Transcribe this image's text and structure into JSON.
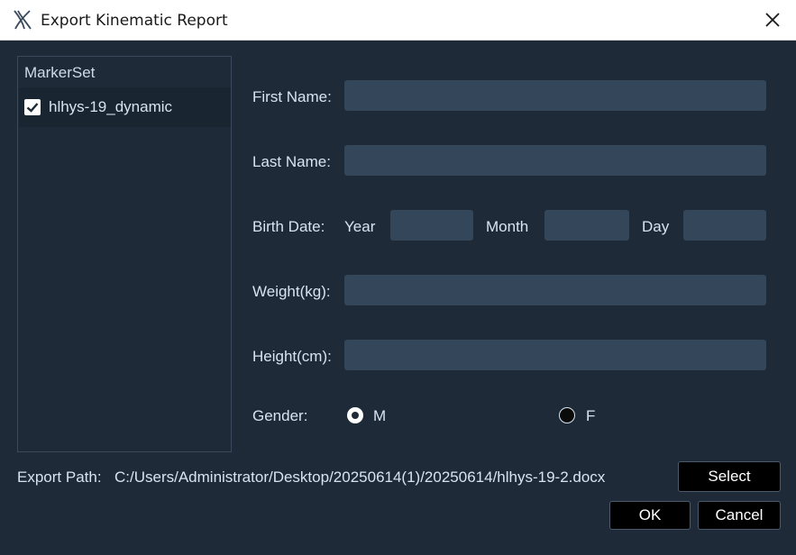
{
  "window": {
    "title": "Export Kinematic Report",
    "app_icon": "app-logo-icon",
    "close_icon": "close-icon"
  },
  "markerset": {
    "header": "MarkerSet",
    "items": [
      {
        "label": "hlhys-19_dynamic",
        "checked": true
      }
    ]
  },
  "form": {
    "first_name": {
      "label": "First Name:",
      "value": ""
    },
    "last_name": {
      "label": "Last Name:",
      "value": ""
    },
    "birth_date": {
      "label": "Birth Date:",
      "year_label": "Year",
      "year_value": "",
      "month_label": "Month",
      "month_value": "",
      "day_label": "Day",
      "day_value": ""
    },
    "weight": {
      "label": "Weight(kg):",
      "value": ""
    },
    "height": {
      "label": "Height(cm):",
      "value": ""
    },
    "gender": {
      "label": "Gender:",
      "options": [
        {
          "label": "M",
          "selected": true
        },
        {
          "label": "F",
          "selected": false
        }
      ]
    }
  },
  "export": {
    "label": "Export Path:",
    "path": "C:/Users/Administrator/Desktop/20250614(1)/20250614/hlhys-19-2.docx",
    "select_button": "Select"
  },
  "buttons": {
    "ok": "OK",
    "cancel": "Cancel"
  },
  "colors": {
    "background": "#1e2a38",
    "field": "#34465a",
    "text": "#d6e4f0",
    "button": "#000000"
  }
}
